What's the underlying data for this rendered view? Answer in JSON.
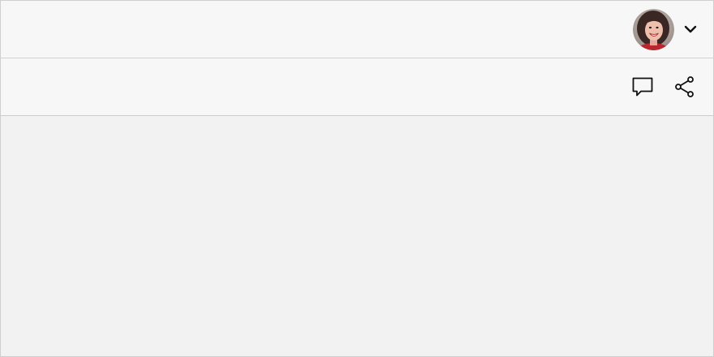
{
  "header": {
    "avatar_icon": "user-avatar",
    "menu_icon": "chevron-down-icon"
  },
  "toolbar": {
    "comment_icon": "comment-icon",
    "share_icon": "share-icon"
  },
  "colors": {
    "bar_background": "#f7f7f7",
    "content_background": "#f2f2f2",
    "border": "#d2d2d2",
    "icon": "#111111"
  }
}
